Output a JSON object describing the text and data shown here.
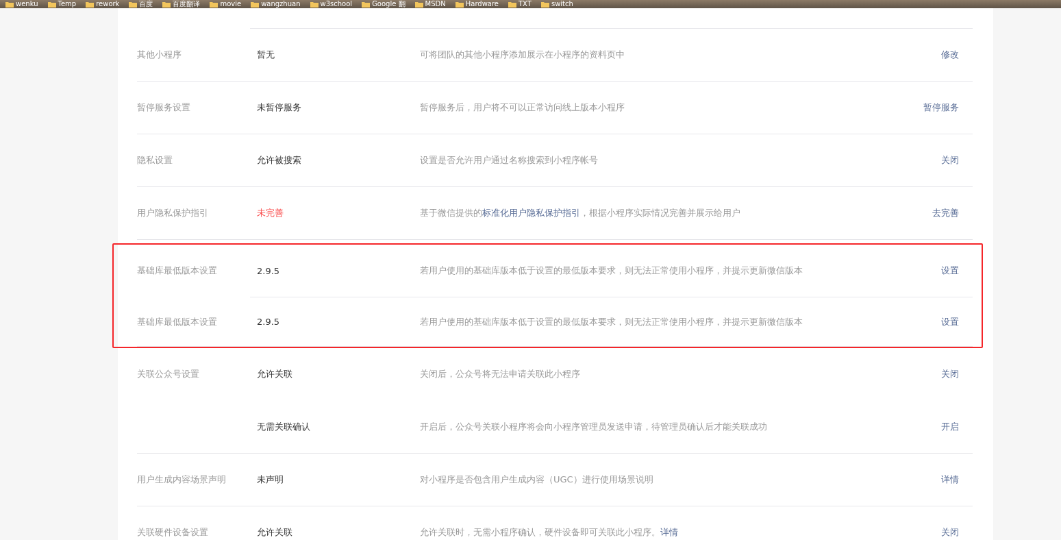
{
  "bookmarks": [
    {
      "label": "wenku"
    },
    {
      "label": "Temp"
    },
    {
      "label": "rework"
    },
    {
      "label": "百度"
    },
    {
      "label": "百度翻译"
    },
    {
      "label": "movie"
    },
    {
      "label": "wangzhuan"
    },
    {
      "label": "w3school"
    },
    {
      "label": "Google 翻"
    },
    {
      "label": "MSDN"
    },
    {
      "label": "Hardware"
    },
    {
      "label": "TXT"
    },
    {
      "label": "switch"
    }
  ],
  "rows": [
    {
      "label": "其他小程序",
      "value": "暂无",
      "warning": false,
      "description": [
        {
          "text": "可将团队的其他小程序添加展示在小程序的资料页中",
          "link": false
        }
      ],
      "action": "修改",
      "highlighted": false,
      "divider": true
    },
    {
      "label": "暂停服务设置",
      "value": "未暂停服务",
      "warning": false,
      "description": [
        {
          "text": "暂停服务后，用户将不可以正常访问线上版本小程序",
          "link": false
        }
      ],
      "action": "暂停服务",
      "highlighted": false,
      "divider": true
    },
    {
      "label": "隐私设置",
      "value": "允许被搜索",
      "warning": false,
      "description": [
        {
          "text": "设置是否允许用户通过名称搜索到小程序帐号",
          "link": false
        }
      ],
      "action": "关闭",
      "highlighted": false,
      "divider": true
    },
    {
      "label": "用户隐私保护指引",
      "value": "未完善",
      "warning": true,
      "description": [
        {
          "text": "基于微信提供的",
          "link": false
        },
        {
          "text": "标准化用户隐私保护指引",
          "link": true
        },
        {
          "text": "，根据小程序实际情况完善并展示给用户",
          "link": false
        }
      ],
      "action": "去完善",
      "highlighted": false,
      "divider": true
    },
    {
      "label": "基础库最低版本设置",
      "value": "2.9.5",
      "warning": false,
      "description": [
        {
          "text": "若用户使用的基础库版本低于设置的最低版本要求，则无法正常使用小程序，并提示更新微信版本",
          "link": false
        }
      ],
      "action": "设置",
      "highlighted": true,
      "divider": true
    },
    {
      "label": "基础库最低版本设置",
      "value": "2.9.5",
      "warning": false,
      "description": [
        {
          "text": "若用户使用的基础库版本低于设置的最低版本要求，则无法正常使用小程序，并提示更新微信版本",
          "link": false
        }
      ],
      "action": "设置",
      "highlighted": true,
      "divider": true
    },
    {
      "label": "关联公众号设置",
      "value": "允许关联",
      "warning": false,
      "description": [
        {
          "text": "关闭后，公众号将无法申请关联此小程序",
          "link": false
        }
      ],
      "action": "关闭",
      "highlighted": false,
      "divider": false
    },
    {
      "value": "无需关联确认",
      "warning": false,
      "description": [
        {
          "text": "开启后，公众号关联小程序将会向小程序管理员发送申请，待管理员确认后才能关联成功",
          "link": false
        }
      ],
      "action": "开启",
      "highlighted": false,
      "divider": true
    },
    {
      "label": "用户生成内容场景声明",
      "value": "未声明",
      "warning": false,
      "description": [
        {
          "text": "对小程序是否包含用户生成内容（UGC）进行使用场景说明",
          "link": false
        }
      ],
      "action": "详情",
      "highlighted": false,
      "divider": true
    },
    {
      "label": "关联硬件设备设置",
      "value": "允许关联",
      "warning": false,
      "description": [
        {
          "text": "允许关联时，无需小程序确认，硬件设备即可关联此小程序。",
          "link": false
        },
        {
          "text": "详情",
          "link": true
        }
      ],
      "action": "关闭",
      "highlighted": false,
      "divider": true
    }
  ]
}
